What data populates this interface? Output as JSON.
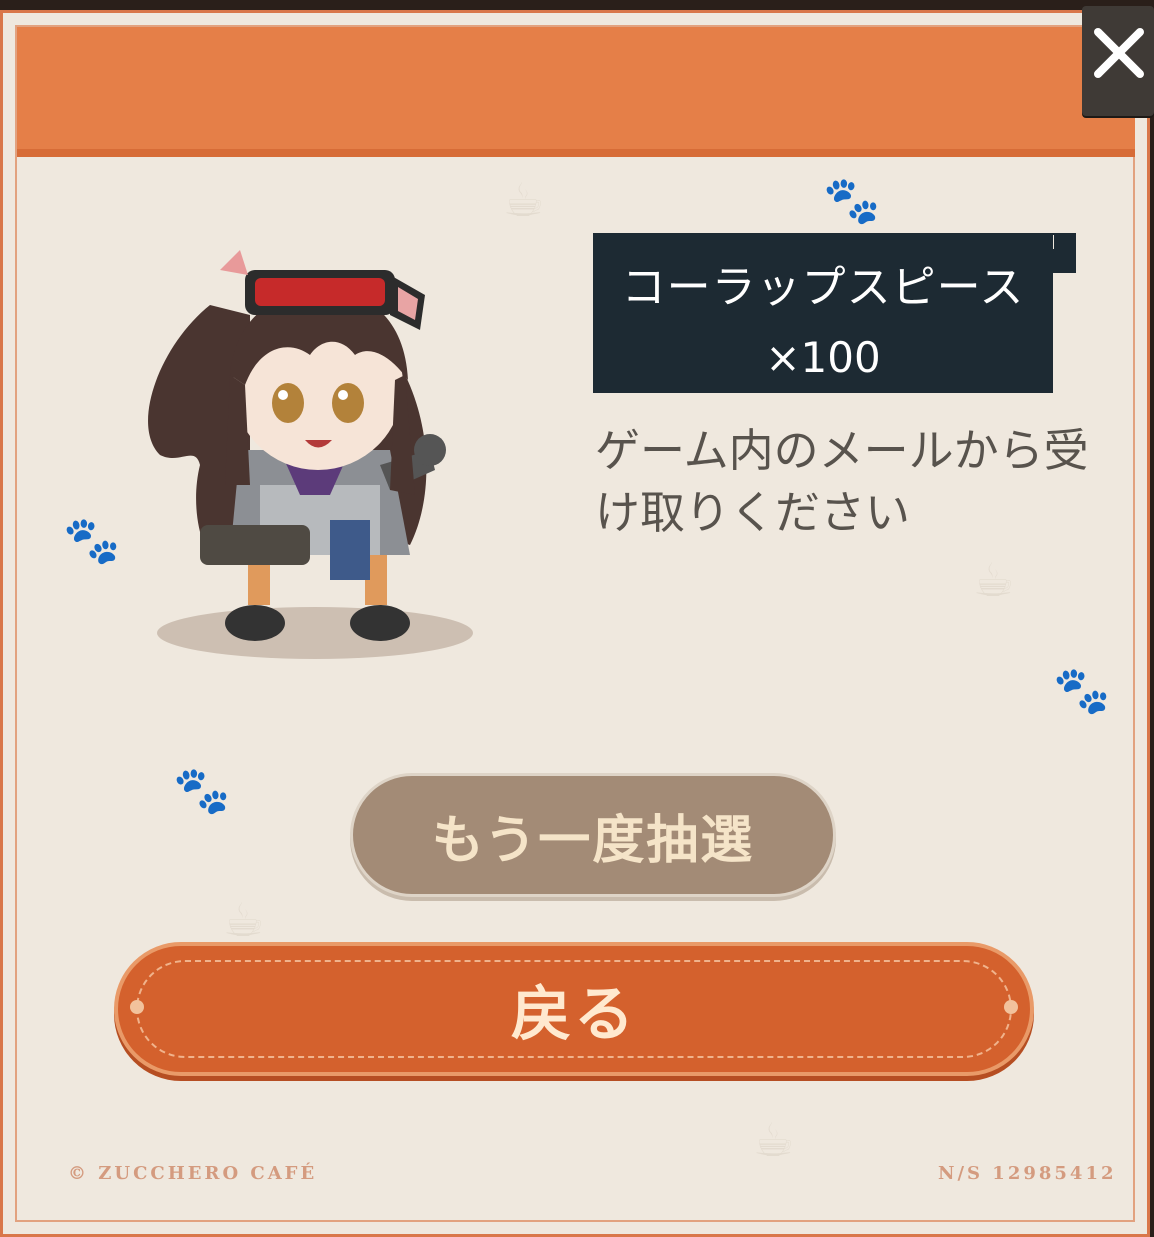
{
  "dialog": {
    "item_name": "コーラップスピース",
    "item_quantity": "×100",
    "mail_message": "ゲーム内のメールから受け取りください",
    "retry_label": "もう一度抽選",
    "back_label": "戻る",
    "close_icon": "close-icon"
  },
  "footer": {
    "copyright": "© ZUCCHERO CAFÉ",
    "serial": "N/S 12985412"
  },
  "colors": {
    "accent": "#e57f48",
    "panel": "#efe8de",
    "item_box": "#1d2a33",
    "retry": "#a38b76",
    "back": "#d4612d"
  }
}
